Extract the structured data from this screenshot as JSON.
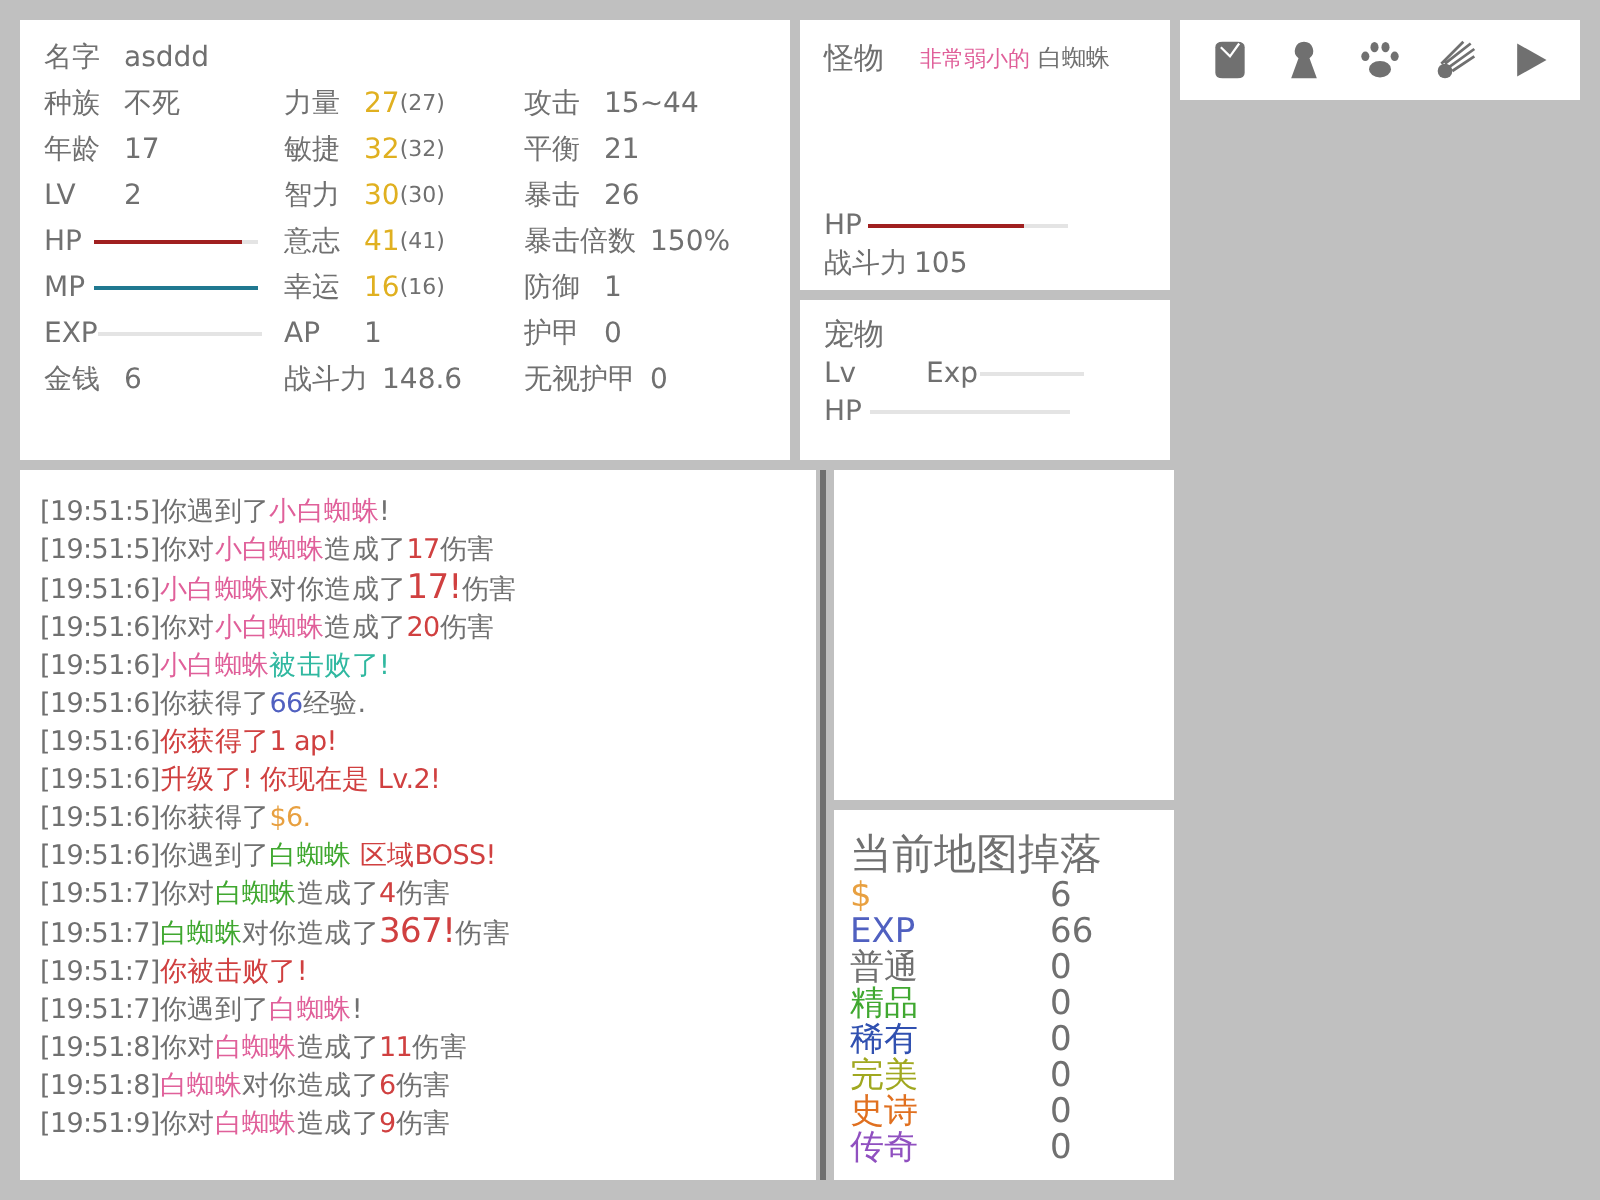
{
  "character": {
    "name": {
      "label": "名字",
      "value": "asddd"
    },
    "columns": [
      [
        {
          "kind": "text",
          "label": "种族",
          "value": "不死"
        },
        {
          "kind": "text",
          "label": "年龄",
          "value": "17"
        },
        {
          "kind": "text",
          "label": "LV",
          "value": "2"
        },
        {
          "kind": "bar",
          "label": "HP",
          "level": 0.9,
          "color": "#a02020"
        },
        {
          "kind": "bar",
          "label": "MP",
          "level": 1,
          "color": "#207890"
        },
        {
          "kind": "bar",
          "label": "EXP"
        },
        {
          "kind": "text",
          "label": "金钱",
          "value": "6"
        }
      ],
      [
        {
          "kind": "stat",
          "label": "力量",
          "value": "27",
          "base": "(27)"
        },
        {
          "kind": "stat",
          "label": "敏捷",
          "value": "32",
          "base": "(32)"
        },
        {
          "kind": "stat",
          "label": "智力",
          "value": "30",
          "base": "(30)"
        },
        {
          "kind": "stat",
          "label": "意志",
          "value": "41",
          "base": "(41)"
        },
        {
          "kind": "stat",
          "label": "幸运",
          "value": "16",
          "base": "(16)"
        },
        {
          "kind": "text",
          "label": "AP",
          "value": "1"
        },
        {
          "kind": "text",
          "label": "战斗力",
          "value": "148.6"
        }
      ],
      [
        {
          "kind": "text",
          "label": "攻击",
          "value": "15~44"
        },
        {
          "kind": "text",
          "label": "平衡",
          "value": "21"
        },
        {
          "kind": "text",
          "label": "暴击",
          "value": "26"
        },
        {
          "kind": "text",
          "label": "暴击倍数",
          "value": "150%"
        },
        {
          "kind": "text",
          "label": "防御",
          "value": "1"
        },
        {
          "kind": "text",
          "label": "护甲",
          "value": "0"
        },
        {
          "kind": "text",
          "label": "无视护甲",
          "value": "0"
        }
      ]
    ]
  },
  "monster": {
    "label": "怪物",
    "rank": "非常弱小的",
    "name": "白蜘蛛",
    "hp_label": "HP",
    "hp": {
      "level": 0.78
    },
    "power_label": "战斗力",
    "power": "105"
  },
  "pet": {
    "label": "宠物",
    "lv_label": "Lv",
    "exp_label": "Exp",
    "hp_label": "HP"
  },
  "toolbar": [
    {
      "kind": "bag"
    },
    {
      "kind": "pawn"
    },
    {
      "kind": "paw"
    },
    {
      "kind": "comet"
    },
    {
      "kind": "play"
    }
  ],
  "log": [
    {
      "time": "[19:51:5]",
      "parts": [
        {
          "text": "你遇到了",
          "color": "#707070",
          "big": false
        },
        {
          "text": "小白蜘蛛",
          "color": "#e0609a",
          "big": false
        },
        {
          "text": "!",
          "color": "#707070",
          "big": false
        }
      ]
    },
    {
      "time": "[19:51:5]",
      "parts": [
        {
          "text": "你对",
          "color": "#707070",
          "big": false
        },
        {
          "text": "小白蜘蛛",
          "color": "#e0609a",
          "big": false
        },
        {
          "text": "造成了",
          "color": "#707070",
          "big": false
        },
        {
          "text": "17",
          "color": "#d04040",
          "big": false
        },
        {
          "text": "伤害",
          "color": "#707070",
          "big": false
        }
      ]
    },
    {
      "time": "[19:51:6]",
      "parts": [
        {
          "text": "小白蜘蛛",
          "color": "#e0609a",
          "big": false
        },
        {
          "text": "对你造成了",
          "color": "#707070",
          "big": false
        },
        {
          "text": "17!",
          "color": "#d04040",
          "big": true
        },
        {
          "text": "伤害",
          "color": "#707070",
          "big": false
        }
      ]
    },
    {
      "time": "[19:51:6]",
      "parts": [
        {
          "text": "你对",
          "color": "#707070",
          "big": false
        },
        {
          "text": "小白蜘蛛",
          "color": "#e0609a",
          "big": false
        },
        {
          "text": "造成了",
          "color": "#707070",
          "big": false
        },
        {
          "text": "20",
          "color": "#d04040",
          "big": false
        },
        {
          "text": "伤害",
          "color": "#707070",
          "big": false
        }
      ]
    },
    {
      "time": "[19:51:6]",
      "parts": [
        {
          "text": "小白蜘蛛",
          "color": "#e0609a",
          "big": false
        },
        {
          "text": "被击败了!",
          "color": "#30b8a0",
          "big": false
        }
      ]
    },
    {
      "time": "[19:51:6]",
      "parts": [
        {
          "text": "你获得了",
          "color": "#707070",
          "big": false
        },
        {
          "text": "66",
          "color": "#5060c0",
          "big": false
        },
        {
          "text": "经验.",
          "color": "#707070",
          "big": false
        }
      ]
    },
    {
      "time": "[19:51:6]",
      "parts": [
        {
          "text": "你获得了1 ap!",
          "color": "#d04040",
          "big": false
        }
      ]
    },
    {
      "time": "[19:51:6]",
      "parts": [
        {
          "text": "升级了! 你现在是 Lv.2!",
          "color": "#d04040",
          "big": false
        }
      ]
    },
    {
      "time": "[19:51:6]",
      "parts": [
        {
          "text": "你获得了",
          "color": "#707070",
          "big": false
        },
        {
          "text": "$6.",
          "color": "#e8a040",
          "big": false
        }
      ]
    },
    {
      "time": "[19:51:6]",
      "parts": [
        {
          "text": "你遇到了",
          "color": "#707070",
          "big": false
        },
        {
          "text": "白蜘蛛",
          "color": "#40a830",
          "big": false
        },
        {
          "text": " 区域BOSS!",
          "color": "#d04040",
          "big": false
        }
      ]
    },
    {
      "time": "[19:51:7]",
      "parts": [
        {
          "text": "你对",
          "color": "#707070",
          "big": false
        },
        {
          "text": "白蜘蛛",
          "color": "#40a830",
          "big": false
        },
        {
          "text": "造成了",
          "color": "#707070",
          "big": false
        },
        {
          "text": "4",
          "color": "#d04040",
          "big": false
        },
        {
          "text": "伤害",
          "color": "#707070",
          "big": false
        }
      ]
    },
    {
      "time": "[19:51:7]",
      "parts": [
        {
          "text": "白蜘蛛",
          "color": "#40a830",
          "big": false
        },
        {
          "text": "对你造成了",
          "color": "#707070",
          "big": false
        },
        {
          "text": "367!",
          "color": "#d04040",
          "big": true
        },
        {
          "text": "伤害",
          "color": "#707070",
          "big": false
        }
      ]
    },
    {
      "time": "[19:51:7]",
      "parts": [
        {
          "text": "你被击败了!",
          "color": "#d04040",
          "big": false
        }
      ]
    },
    {
      "time": "[19:51:7]",
      "parts": [
        {
          "text": "你遇到了",
          "color": "#707070",
          "big": false
        },
        {
          "text": "白蜘蛛",
          "color": "#e0609a",
          "big": false
        },
        {
          "text": "!",
          "color": "#707070",
          "big": false
        }
      ]
    },
    {
      "time": "[19:51:8]",
      "parts": [
        {
          "text": "你对",
          "color": "#707070",
          "big": false
        },
        {
          "text": "白蜘蛛",
          "color": "#e0609a",
          "big": false
        },
        {
          "text": "造成了",
          "color": "#707070",
          "big": false
        },
        {
          "text": "11",
          "color": "#d04040",
          "big": false
        },
        {
          "text": "伤害",
          "color": "#707070",
          "big": false
        }
      ]
    },
    {
      "time": "[19:51:8]",
      "parts": [
        {
          "text": "白蜘蛛",
          "color": "#e0609a",
          "big": false
        },
        {
          "text": "对你造成了",
          "color": "#707070",
          "big": false
        },
        {
          "text": "6",
          "color": "#d04040",
          "big": false
        },
        {
          "text": "伤害",
          "color": "#707070",
          "big": false
        }
      ]
    },
    {
      "time": "[19:51:9]",
      "parts": [
        {
          "text": "你对",
          "color": "#707070",
          "big": false
        },
        {
          "text": "白蜘蛛",
          "color": "#e0609a",
          "big": false
        },
        {
          "text": "造成了",
          "color": "#707070",
          "big": false
        },
        {
          "text": "9",
          "color": "#d04040",
          "big": false
        },
        {
          "text": "伤害",
          "color": "#707070",
          "big": false
        }
      ]
    }
  ],
  "drops": {
    "title": "当前地图掉落",
    "items": [
      {
        "label": "$",
        "value": "6",
        "color": "#e8a040"
      },
      {
        "label": "EXP",
        "value": "66",
        "color": "#5060c0"
      },
      {
        "label": "普通",
        "value": "0",
        "color": "#707070"
      },
      {
        "label": "精品",
        "value": "0",
        "color": "#40a830"
      },
      {
        "label": "稀有",
        "value": "0",
        "color": "#3050b0"
      },
      {
        "label": "完美",
        "value": "0",
        "color": "#a0a820"
      },
      {
        "label": "史诗",
        "value": "0",
        "color": "#e07020"
      },
      {
        "label": "传奇",
        "value": "0",
        "color": "#9050c0"
      }
    ]
  }
}
